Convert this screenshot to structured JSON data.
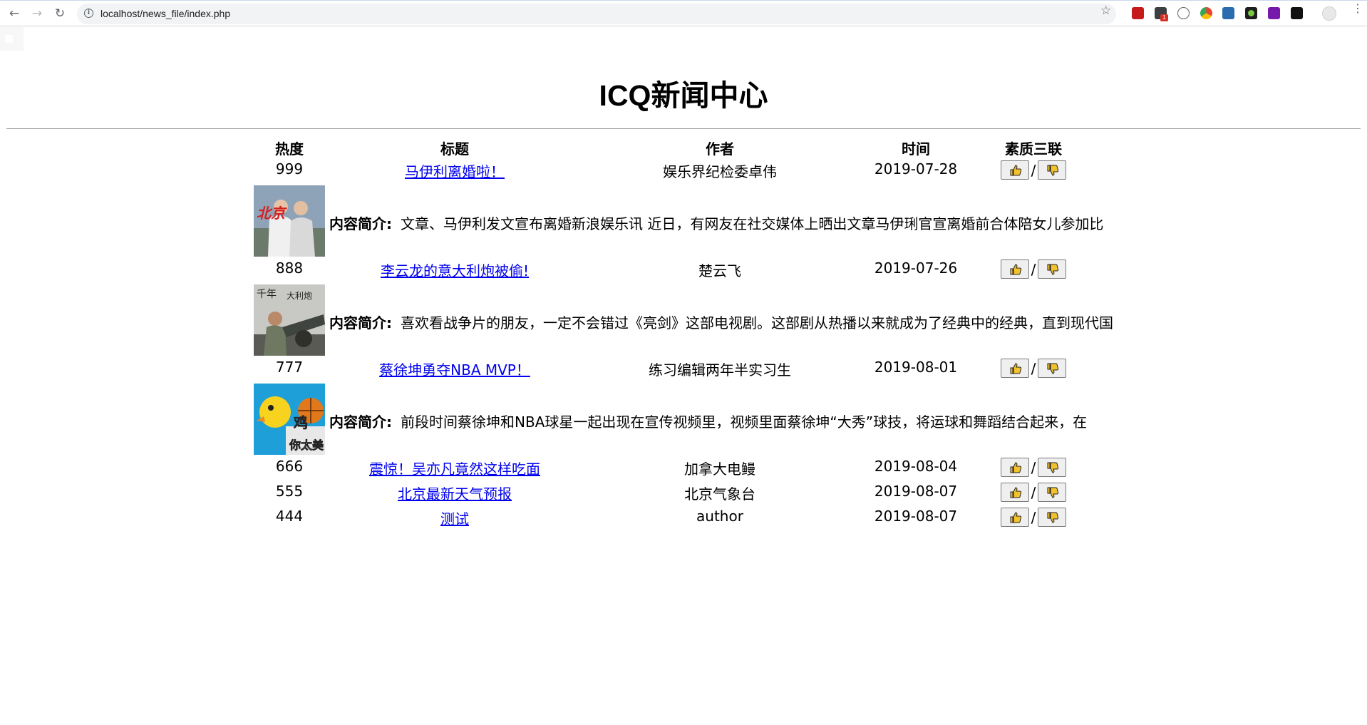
{
  "browser": {
    "url": "localhost/news_file/index.php",
    "extension_badge": "1"
  },
  "page": {
    "title": "ICQ新闻中心"
  },
  "table": {
    "headers": {
      "hot": "热度",
      "title": "标题",
      "author": "作者",
      "time": "时间",
      "vote": "素质三联"
    },
    "vote_separator": "/",
    "summary_label": "内容简介:",
    "rows": [
      {
        "hot": "999",
        "title": "马伊利离婚啦！",
        "author": "娱乐界纪检委卓伟",
        "time": "2019-07-28",
        "summary": "文章、马伊利发文宣布离婚新浪娱乐讯 近日，有网友在社交媒体上晒出文章马伊琍官宣离婚前合体陪女儿参加比"
      },
      {
        "hot": "888",
        "title": "李云龙的意大利炮被偷!",
        "author": "楚云飞",
        "time": "2019-07-26",
        "summary": "喜欢看战争片的朋友，一定不会错过《亮剑》这部电视剧。这部剧从热播以来就成为了经典中的经典，直到现代国"
      },
      {
        "hot": "777",
        "title": "蔡徐坤勇夺NBA MVP！",
        "author": "练习编辑两年半实习生",
        "time": "2019-08-01",
        "summary": "前段时间蔡徐坤和NBA球星一起出现在宣传视频里，视频里面蔡徐坤“大秀”球技，将运球和舞蹈结合起来，在"
      },
      {
        "hot": "666",
        "title": "震惊！吴亦凡竟然这样吃面",
        "author": "加拿大电鳗",
        "time": "2019-08-04"
      },
      {
        "hot": "555",
        "title": "北京最新天气预报",
        "author": "北京气象台",
        "time": "2019-08-07"
      },
      {
        "hot": "444",
        "title": "测试",
        "author": "author",
        "time": "2019-08-07"
      }
    ]
  }
}
